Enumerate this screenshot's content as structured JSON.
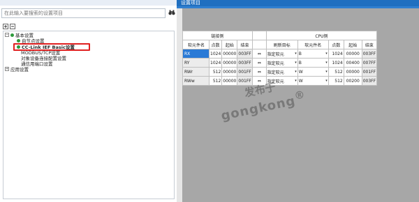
{
  "panel": {
    "title": "设置项目"
  },
  "search": {
    "placeholder": "在此输入要搜索的设置项目"
  },
  "tree": {
    "items": [
      {
        "label": "基本设置",
        "expander": "⊟"
      },
      {
        "label": "自节点设置"
      },
      {
        "label": "CC-Link IEF Basic设置"
      },
      {
        "label": "MODBUS/TCP设置"
      },
      {
        "label": "对象设备连接配置设置"
      },
      {
        "label": "通信用端口设置"
      },
      {
        "label": "应用设置",
        "expander": "⊞"
      }
    ]
  },
  "table": {
    "group_link": "链接侧",
    "group_cpu": "CPU侧",
    "headers": [
      "软元件名",
      "点数",
      "起始",
      "结束",
      "刷新目标",
      "软元件名",
      "点数",
      "起始",
      "结束"
    ],
    "rows": [
      {
        "name": "RX",
        "points": "1024",
        "start": "00000",
        "end": "003FF",
        "target": "指定软元",
        "dev": "B",
        "cpu_points": "1024",
        "cpu_start": "00000",
        "cpu_end": "003FF"
      },
      {
        "name": "RY",
        "points": "1024",
        "start": "00000",
        "end": "003FF",
        "target": "指定软元",
        "dev": "B",
        "cpu_points": "1024",
        "cpu_start": "00400",
        "cpu_end": "007FF"
      },
      {
        "name": "RWr",
        "points": "512",
        "start": "00000",
        "end": "001FF",
        "target": "指定软元",
        "dev": "W",
        "cpu_points": "512",
        "cpu_start": "00000",
        "cpu_end": "001FF"
      },
      {
        "name": "RWw",
        "points": "512",
        "start": "00000",
        "end": "001FF",
        "target": "指定软元",
        "dev": "W",
        "cpu_points": "512",
        "cpu_start": "00200",
        "cpu_end": "003FF"
      }
    ],
    "arrow_glyph": "⇔",
    "dropdown_glyph": "▾"
  },
  "watermark": {
    "line1": "发布于",
    "line2": "gongkong",
    "mark": "®"
  },
  "colors": {
    "title_bar": "#1f6fc0",
    "selection": "#2a7ad6",
    "highlight": "#e02020",
    "ok_status": "#2e9a3c"
  }
}
